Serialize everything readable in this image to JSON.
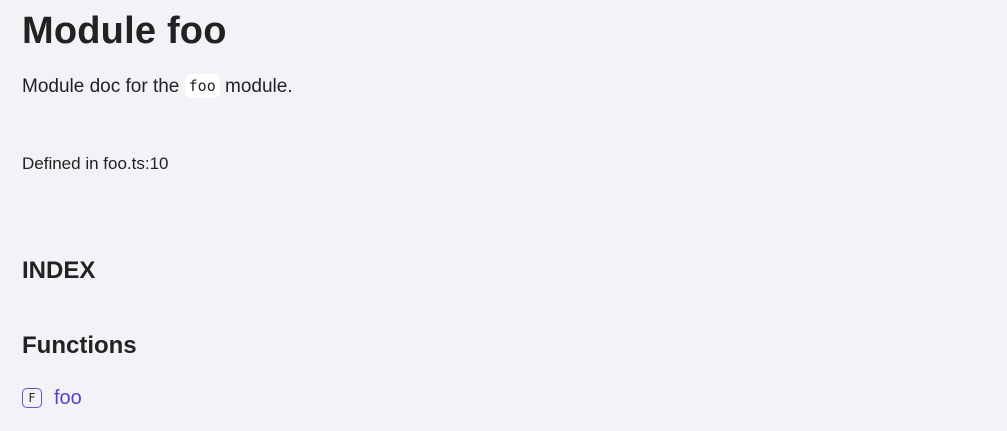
{
  "module": {
    "title": "Module foo",
    "doc_prefix": "Module doc for the ",
    "doc_code": "foo",
    "doc_suffix": " module.",
    "defined_in": "Defined in foo.ts:10"
  },
  "index": {
    "heading": "INDEX",
    "groups": [
      {
        "heading": "Functions",
        "items": [
          {
            "kind_letter": "F",
            "kind_icon": "function-kind-icon",
            "name": "foo"
          }
        ]
      }
    ]
  },
  "colors": {
    "background": "#f2f3f7",
    "text": "#222222",
    "link": "#5b3fcf",
    "icon_border": "#6e4fd6"
  }
}
